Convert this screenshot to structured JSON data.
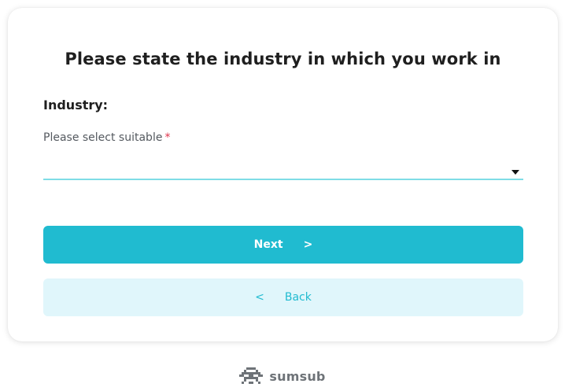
{
  "form": {
    "title": "Please state the industry in which you work in",
    "section_label": "Industry:",
    "field_label": "Please select suitable",
    "required_marker": "*",
    "selected_value": ""
  },
  "buttons": {
    "next_label": "Next",
    "next_chevron": ">",
    "back_chevron": "<",
    "back_label": "Back"
  },
  "footer": {
    "logo_text": "sumsub"
  },
  "colors": {
    "accent": "#20bbd0",
    "accent_light": "#e0f6fb",
    "underline": "#7fdde6",
    "required": "#e0344b"
  },
  "icons": {
    "dropdown": "caret-down-icon",
    "logo": "sumsub-logo-icon"
  }
}
